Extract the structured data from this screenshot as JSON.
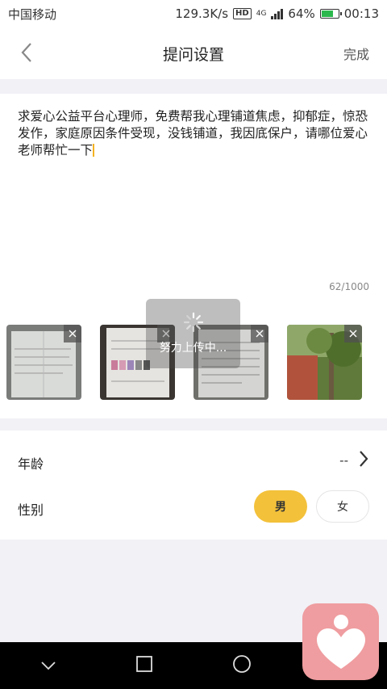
{
  "status": {
    "carrier": "中国移动",
    "speed": "129.3K/s",
    "hd": "HD",
    "network": "4G",
    "battery": "64%",
    "time": "00:13"
  },
  "nav": {
    "title": "提问设置",
    "done_label": "完成"
  },
  "question": {
    "text": "求爱心公益平台心理师，免费帮我心理铺道焦虑，抑郁症，惊恐发作，家庭原因条件受现，没钱铺道，我因底保户，请哪位爱心老师帮忙一下",
    "counter": "62/1000"
  },
  "loading": {
    "text": "努力上传中..."
  },
  "form": {
    "age_label": "年龄",
    "age_value": "--",
    "gender_label": "性别",
    "male": "男",
    "female": "女",
    "selected": "男"
  },
  "colors": {
    "accent": "#f3c13a",
    "fab": "#ef9da0",
    "battery": "#2db84d"
  }
}
